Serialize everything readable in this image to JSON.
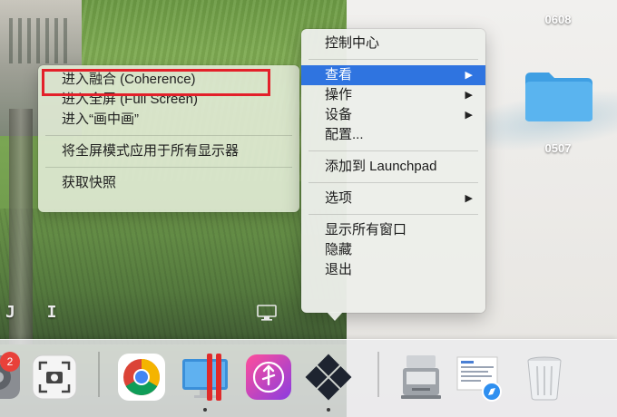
{
  "desktop": {
    "items": [
      {
        "label": "0608",
        "icon": "folder-icon"
      },
      {
        "label": "0507",
        "icon": "folder-icon"
      }
    ],
    "folder_color": "#5ab4ef"
  },
  "photo_window": {
    "caption": "J I"
  },
  "main_menu": {
    "items": [
      {
        "label": "控制中心"
      },
      {
        "label": "查看",
        "submenu": true,
        "active": true
      },
      {
        "label": "操作",
        "submenu": true
      },
      {
        "label": "设备",
        "submenu": true
      },
      {
        "label": "配置..."
      },
      {
        "label": "添加到 Launchpad"
      },
      {
        "label": "选项",
        "submenu": true
      },
      {
        "label": "显示所有窗口"
      },
      {
        "label": "隐藏"
      },
      {
        "label": "退出"
      }
    ],
    "submenu_arrow": "▶",
    "highlight_color": "#2f74e0"
  },
  "view_submenu": {
    "items": [
      {
        "label": "进入融合 (Coherence)",
        "highlighted_box": true
      },
      {
        "label": "进入全屏 (Full Screen)"
      },
      {
        "label": "进入“画中画”"
      },
      {
        "label": "将全屏模式应用于所有显示器"
      },
      {
        "label": "获取快照"
      }
    ],
    "annotation_color": "#e3202a"
  },
  "dock": {
    "badge_count": "2",
    "apps": [
      {
        "icon": "system-preferences-icon"
      },
      {
        "icon": "screenshot-icon"
      },
      {
        "icon": "chrome-icon"
      },
      {
        "icon": "parallels-desktop-icon"
      },
      {
        "icon": "music-converter-icon"
      },
      {
        "icon": "windows-vm-icon"
      },
      {
        "icon": "disk-utility-icon"
      },
      {
        "icon": "document-safari-icon"
      },
      {
        "icon": "trash-icon"
      }
    ]
  }
}
